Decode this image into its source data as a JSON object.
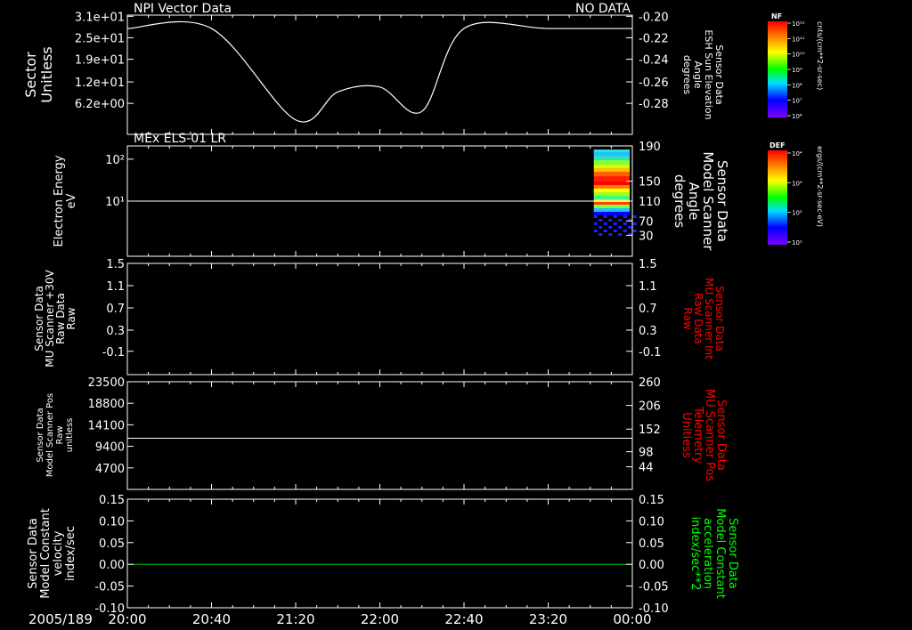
{
  "date_label": "2005/189",
  "x_ticks": [
    "20:00",
    "20:40",
    "21:20",
    "22:00",
    "22:40",
    "23:20",
    "00:00"
  ],
  "colors": {
    "background": "#000000",
    "foreground": "#ffffff",
    "red_label": "#ff0000",
    "green_label": "#00ff00",
    "green_line": "#00c000"
  },
  "panels": [
    {
      "title_left": "NPI Vector Data",
      "title_right": "NO DATA",
      "left_label": [
        "Sector",
        "Unitless"
      ],
      "left_ticks": [
        "3.1e+01",
        "2.5e+01",
        "1.9e+01",
        "1.2e+01",
        "6.2e+00"
      ],
      "right_label": [
        "Sensor Data",
        "ESH Sun Elevation",
        "Angle",
        "degrees"
      ],
      "right_ticks": [
        "-0.20",
        "-0.22",
        "-0.24",
        "-0.26",
        "-0.28"
      ],
      "colorbar": {
        "title": "NF",
        "unit": "cnts/(cm**2-sr-sec)",
        "ticks": [
          "10¹²",
          "10¹¹",
          "10¹⁰",
          "10⁹",
          "10⁸",
          "10⁷",
          "10⁶"
        ]
      }
    },
    {
      "title_left": "MEx ELS-01 LR",
      "left_label": [
        "Electron Energy",
        "eV"
      ],
      "left_ticks": [
        "10²",
        "10¹"
      ],
      "right_label": [
        "Sensor Data",
        "Model Scanner",
        "Angle",
        "degrees"
      ],
      "right_ticks": [
        "190",
        "150",
        "110",
        "70",
        "30"
      ],
      "colorbar": {
        "title": "DEF",
        "unit": "ergs/(cm**2-sr-sec-eV)",
        "ticks": [
          "10⁴",
          "10³",
          "10²",
          "10¹"
        ]
      }
    },
    {
      "left_label": [
        "Sensor Data",
        "MU Scanner +30V",
        "Raw Data",
        "Raw"
      ],
      "left_ticks": [
        "1.5",
        "1.1",
        "0.7",
        "0.3",
        "-0.1"
      ],
      "right_label": [
        "Sensor Data",
        "MU Scanner Int",
        "Raw Data",
        "Raw"
      ],
      "right_ticks": [
        "1.5",
        "1.1",
        "0.7",
        "0.3",
        "-0.1"
      ]
    },
    {
      "left_label": [
        "Sensor Data",
        "Model Scanner Pos",
        "Raw",
        "unitless"
      ],
      "left_ticks": [
        "23500",
        "18800",
        "14100",
        "9400",
        "4700"
      ],
      "right_label": [
        "Sensor Data",
        "MU Scanner Pos",
        "Telemetry",
        "Unitless"
      ],
      "right_ticks": [
        "260",
        "206",
        "152",
        "98",
        "44"
      ]
    },
    {
      "left_label": [
        "Sensor Data",
        "Model Constant",
        "velocity",
        "index/sec"
      ],
      "left_ticks": [
        "0.15",
        "0.10",
        "0.05",
        "0.00",
        "-0.05",
        "-0.10"
      ],
      "right_label": [
        "Sensor Data",
        "Model Constant",
        "acceleration",
        "index/sec**2"
      ],
      "right_ticks": [
        "0.15",
        "0.10",
        "0.05",
        "0.00",
        "-0.05",
        "-0.10"
      ]
    }
  ],
  "chart_data": [
    {
      "type": "line",
      "title": "NPI Vector Data",
      "ylabel": "Sector Unitless",
      "y2label": "Sensor Data ESH Sun Elevation Angle degrees",
      "y2lim": [
        -0.29,
        -0.2
      ],
      "x": [
        "20:00",
        "20:40",
        "21:20",
        "21:40",
        "22:00",
        "22:20",
        "22:40",
        "23:20",
        "00:00"
      ],
      "series": [
        {
          "values": [
            -0.21,
            -0.21,
            -0.285,
            -0.262,
            -0.258,
            -0.278,
            -0.21,
            -0.21,
            -0.21
          ]
        }
      ]
    },
    {
      "type": "heatmap",
      "title": "MEx ELS-01 LR",
      "ylabel": "Electron Energy eV",
      "y2label": "Sensor Data Model Scanner Angle degrees",
      "y2lim": [
        10,
        190
      ],
      "x_range": [
        "23:40",
        "00:00"
      ],
      "scanner_angle_line_degrees": 100,
      "note": "NO DATA"
    },
    {
      "type": "line",
      "ylabel": "Sensor Data MU Scanner +30V Raw Data Raw",
      "ylim": [
        -0.3,
        1.5
      ],
      "y2label": "Sensor Data MU Scanner Int Raw Data Raw",
      "series": []
    },
    {
      "type": "line",
      "ylabel": "Sensor Data Model Scanner Pos Raw unitless",
      "ylim": [
        0,
        23500
      ],
      "y2label": "Sensor Data MU Scanner Pos Telemetry Unitless",
      "y2lim": [
        0,
        260
      ],
      "x": [
        "20:00",
        "00:00"
      ],
      "series": [
        {
          "values": [
            11750,
            11750
          ]
        }
      ]
    },
    {
      "type": "line",
      "ylabel": "Sensor Data Model Constant velocity index/sec",
      "ylim": [
        -0.1,
        0.15
      ],
      "y2label": "Sensor Data Model Constant acceleration index/sec**2",
      "y2lim": [
        -0.1,
        0.15
      ],
      "x": [
        "20:00",
        "00:00"
      ],
      "series": [
        {
          "values": [
            0.0,
            0.0
          ]
        }
      ]
    }
  ]
}
